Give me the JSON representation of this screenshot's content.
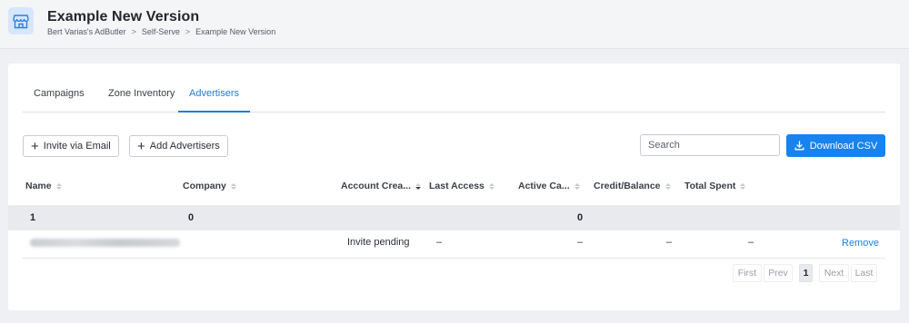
{
  "header": {
    "title": "Example New Version",
    "icon": "store-icon",
    "breadcrumb": [
      "Bert Varias's AdButler",
      "Self-Serve",
      "Example New Version"
    ],
    "separator": ">"
  },
  "tabs": [
    {
      "label": "Campaigns",
      "active": false
    },
    {
      "label": "Zone Inventory",
      "active": false
    },
    {
      "label": "Advertisers",
      "active": true
    }
  ],
  "toolbar": {
    "invite_label": "Invite via Email",
    "add_label": "Add Advertisers",
    "search_placeholder": "Search",
    "download_label": "Download CSV"
  },
  "table": {
    "columns": [
      "Name",
      "Company",
      "Account Crea...",
      "Last Access",
      "Active Ca...",
      "Credit/Balance",
      "Total Spent"
    ],
    "sorted_column": "Account Crea...",
    "sort_direction": "desc",
    "summary": {
      "name": "1",
      "company": "0",
      "active_campaigns": "0"
    },
    "rows": [
      {
        "account_created": "Invite pending",
        "last_access": "–",
        "active_campaigns": "–",
        "credit_balance": "–",
        "total_spent": "–",
        "action": "Remove"
      }
    ]
  },
  "pagination": {
    "first": "First",
    "prev": "Prev",
    "current": "1",
    "next": "Next",
    "last": "Last"
  },
  "colors": {
    "accent": "#1683f0",
    "link": "#1e7ed8",
    "background": "#eef0f3"
  }
}
